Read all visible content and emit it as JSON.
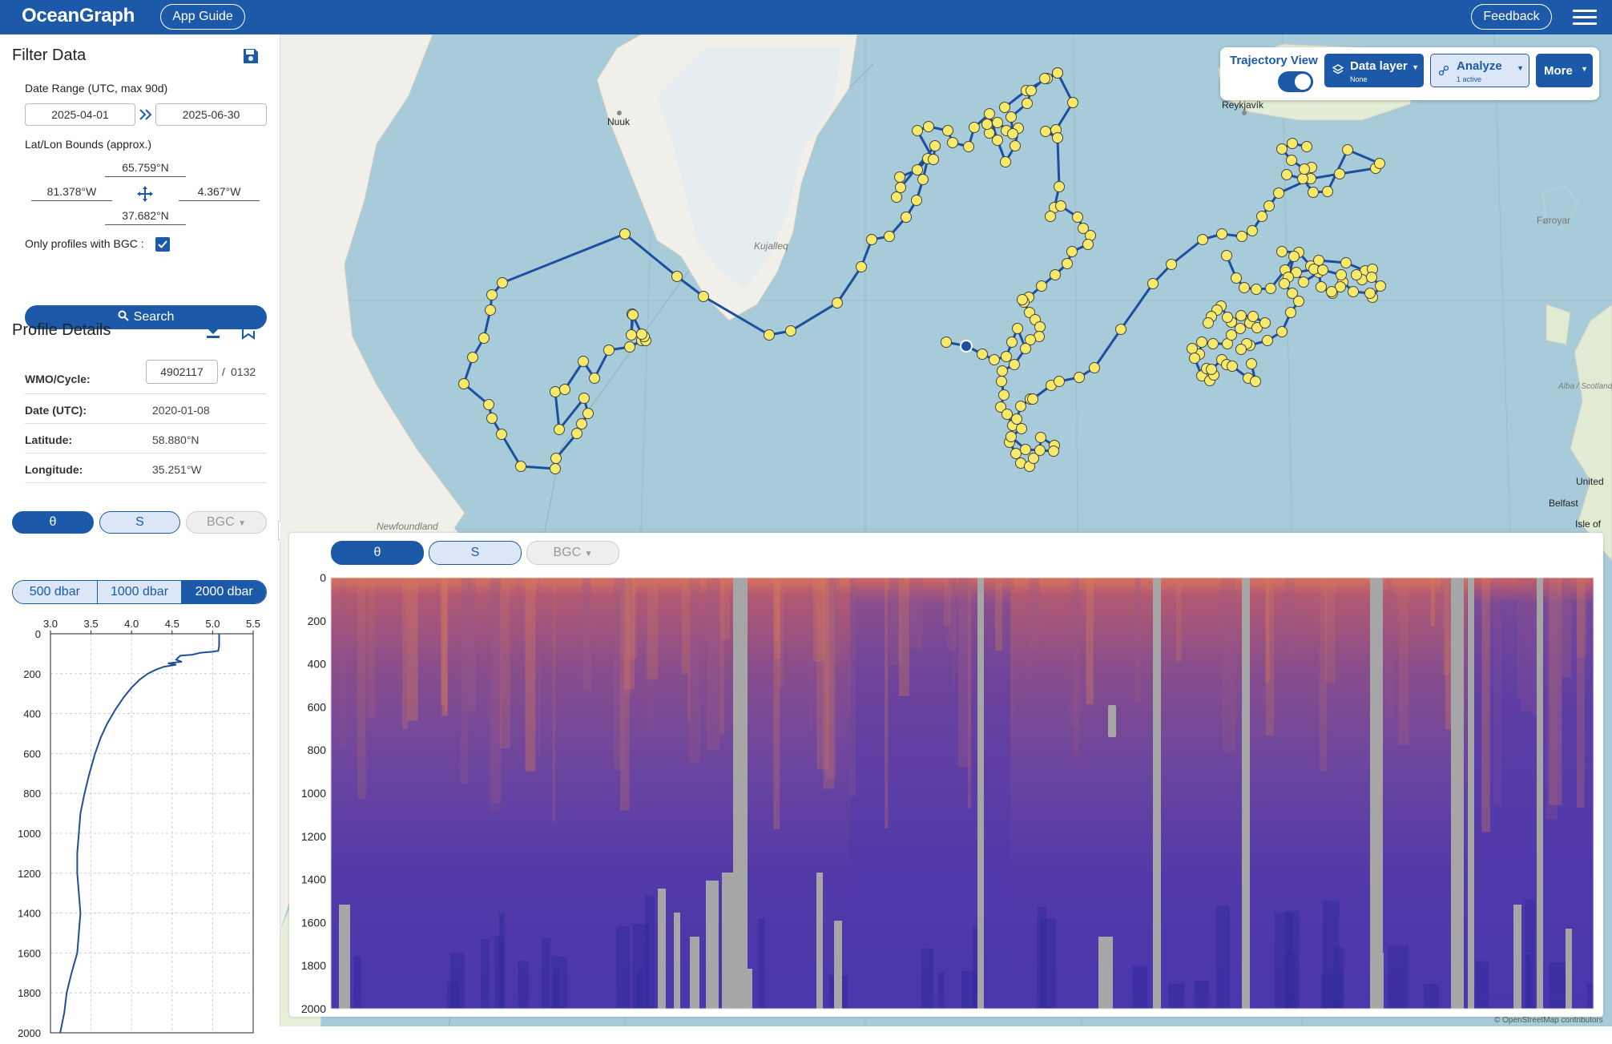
{
  "header": {
    "title": "OceanGraph",
    "app_guide_label": "App Guide",
    "feedback_label": "Feedback",
    "menu_icon": "hamburger-menu-icon"
  },
  "filter": {
    "title": "Filter Data",
    "save_icon": "save-icon",
    "date_range_label": "Date Range (UTC, max 90d)",
    "date_start": "2025-04-01",
    "date_end": "2025-06-30",
    "bounds_label": "Lat/Lon Bounds (approx.)",
    "north": "65.759°N",
    "west": "81.378°W",
    "east": "4.367°W",
    "south": "37.682°N",
    "bgc_only_label": "Only profiles with BGC :",
    "bgc_only_checked": true,
    "search_label": "Search"
  },
  "profile": {
    "title": "Profile Details",
    "wmo_label": "WMO/Cycle:",
    "wmo": "4902117",
    "cycle_sep": "/",
    "cycle": "0132",
    "date_label": "Date (UTC):",
    "date": "2020-01-08",
    "lat_label": "Latitude:",
    "lat": "58.880°N",
    "lon_label": "Longitude:",
    "lon": "35.251°W"
  },
  "profile_chart": {
    "var_buttons": [
      "θ",
      "S",
      "BGC"
    ],
    "depth_buttons": [
      "500 dbar",
      "1000 dbar",
      "2000 dbar"
    ],
    "active_depth": "2000 dbar",
    "x_ticks": [
      "3.0",
      "3.5",
      "4.0",
      "4.5",
      "5.0",
      "5.5"
    ],
    "y_ticks": [
      "0",
      "200",
      "400",
      "600",
      "800",
      "1000",
      "1200",
      "1400",
      "1600",
      "1800",
      "2000"
    ]
  },
  "map": {
    "trajectory_label": "Trajectory View",
    "trajectory_on": true,
    "data_layer_label": "Data layer",
    "data_layer_value": "None",
    "analyze_label": "Analyze",
    "analyze_sub": "1 active",
    "more_label": "More",
    "place_labels": [
      "Nuuk",
      "Kujalleq",
      "Reykjavík",
      "Føroyar",
      "Newfoundland",
      "Alba / Scotland",
      "United",
      "Belfast",
      "Isle of"
    ],
    "attribution": "© OpenStreetMap contributors",
    "colors": {
      "track": "#1c4fa0",
      "point": "#f7ea6a",
      "land": "#f2efe9",
      "sea": "#a7cbd8"
    }
  },
  "section_chart": {
    "var_buttons": [
      "θ",
      "S",
      "BGC"
    ],
    "y_ticks": [
      "0",
      "200",
      "400",
      "600",
      "800",
      "1000",
      "1200",
      "1400",
      "1600",
      "1800",
      "2000"
    ]
  }
}
